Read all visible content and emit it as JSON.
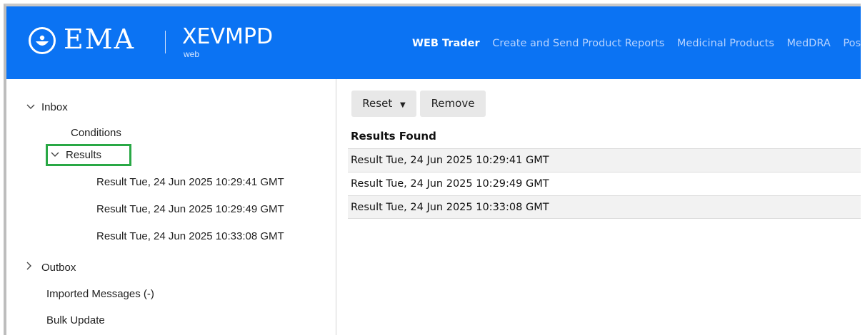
{
  "header": {
    "logo_text": "EMA",
    "app_name": "XEVMPD",
    "app_sub": "web",
    "nav": [
      "WEB Trader",
      "Create and Send Product Reports",
      "Medicinal Products",
      "MedDRA",
      "Post"
    ],
    "active_nav": "WEB Trader",
    "brand_color": "#0b73f3"
  },
  "sidebar": {
    "inbox": "Inbox",
    "conditions": "Conditions",
    "results": "Results",
    "result_items": [
      "Result Tue, 24 Jun 2025 10:29:41 GMT",
      "Result Tue, 24 Jun 2025 10:29:49 GMT",
      "Result Tue, 24 Jun 2025 10:33:08 GMT"
    ],
    "outbox": "Outbox",
    "imported": "Imported Messages (-)",
    "bulk": "Bulk Update",
    "highlight_color": "#29a845"
  },
  "main": {
    "reset_label": "Reset",
    "remove_label": "Remove",
    "results_title": "Results Found",
    "rows": [
      "Result Tue, 24 Jun 2025 10:29:41 GMT",
      "Result Tue, 24 Jun 2025 10:29:49 GMT",
      "Result Tue, 24 Jun 2025 10:33:08 GMT"
    ]
  },
  "icons": [
    "logo-icon",
    "chevron-down-icon",
    "chevron-right-icon",
    "caret-down-icon"
  ]
}
